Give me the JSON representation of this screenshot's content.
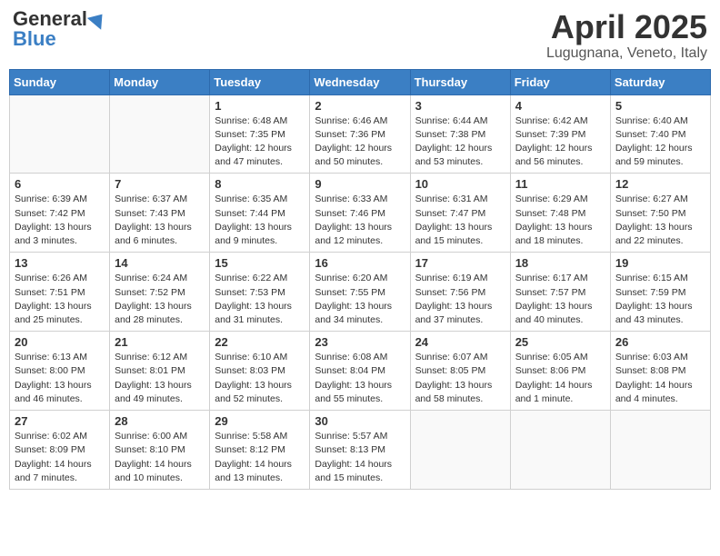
{
  "header": {
    "logo_general": "General",
    "logo_blue": "Blue",
    "title": "April 2025",
    "location": "Lugugnana, Veneto, Italy"
  },
  "weekdays": [
    "Sunday",
    "Monday",
    "Tuesday",
    "Wednesday",
    "Thursday",
    "Friday",
    "Saturday"
  ],
  "weeks": [
    [
      {
        "day": "",
        "info": ""
      },
      {
        "day": "",
        "info": ""
      },
      {
        "day": "1",
        "info": "Sunrise: 6:48 AM\nSunset: 7:35 PM\nDaylight: 12 hours and 47 minutes."
      },
      {
        "day": "2",
        "info": "Sunrise: 6:46 AM\nSunset: 7:36 PM\nDaylight: 12 hours and 50 minutes."
      },
      {
        "day": "3",
        "info": "Sunrise: 6:44 AM\nSunset: 7:38 PM\nDaylight: 12 hours and 53 minutes."
      },
      {
        "day": "4",
        "info": "Sunrise: 6:42 AM\nSunset: 7:39 PM\nDaylight: 12 hours and 56 minutes."
      },
      {
        "day": "5",
        "info": "Sunrise: 6:40 AM\nSunset: 7:40 PM\nDaylight: 12 hours and 59 minutes."
      }
    ],
    [
      {
        "day": "6",
        "info": "Sunrise: 6:39 AM\nSunset: 7:42 PM\nDaylight: 13 hours and 3 minutes."
      },
      {
        "day": "7",
        "info": "Sunrise: 6:37 AM\nSunset: 7:43 PM\nDaylight: 13 hours and 6 minutes."
      },
      {
        "day": "8",
        "info": "Sunrise: 6:35 AM\nSunset: 7:44 PM\nDaylight: 13 hours and 9 minutes."
      },
      {
        "day": "9",
        "info": "Sunrise: 6:33 AM\nSunset: 7:46 PM\nDaylight: 13 hours and 12 minutes."
      },
      {
        "day": "10",
        "info": "Sunrise: 6:31 AM\nSunset: 7:47 PM\nDaylight: 13 hours and 15 minutes."
      },
      {
        "day": "11",
        "info": "Sunrise: 6:29 AM\nSunset: 7:48 PM\nDaylight: 13 hours and 18 minutes."
      },
      {
        "day": "12",
        "info": "Sunrise: 6:27 AM\nSunset: 7:50 PM\nDaylight: 13 hours and 22 minutes."
      }
    ],
    [
      {
        "day": "13",
        "info": "Sunrise: 6:26 AM\nSunset: 7:51 PM\nDaylight: 13 hours and 25 minutes."
      },
      {
        "day": "14",
        "info": "Sunrise: 6:24 AM\nSunset: 7:52 PM\nDaylight: 13 hours and 28 minutes."
      },
      {
        "day": "15",
        "info": "Sunrise: 6:22 AM\nSunset: 7:53 PM\nDaylight: 13 hours and 31 minutes."
      },
      {
        "day": "16",
        "info": "Sunrise: 6:20 AM\nSunset: 7:55 PM\nDaylight: 13 hours and 34 minutes."
      },
      {
        "day": "17",
        "info": "Sunrise: 6:19 AM\nSunset: 7:56 PM\nDaylight: 13 hours and 37 minutes."
      },
      {
        "day": "18",
        "info": "Sunrise: 6:17 AM\nSunset: 7:57 PM\nDaylight: 13 hours and 40 minutes."
      },
      {
        "day": "19",
        "info": "Sunrise: 6:15 AM\nSunset: 7:59 PM\nDaylight: 13 hours and 43 minutes."
      }
    ],
    [
      {
        "day": "20",
        "info": "Sunrise: 6:13 AM\nSunset: 8:00 PM\nDaylight: 13 hours and 46 minutes."
      },
      {
        "day": "21",
        "info": "Sunrise: 6:12 AM\nSunset: 8:01 PM\nDaylight: 13 hours and 49 minutes."
      },
      {
        "day": "22",
        "info": "Sunrise: 6:10 AM\nSunset: 8:03 PM\nDaylight: 13 hours and 52 minutes."
      },
      {
        "day": "23",
        "info": "Sunrise: 6:08 AM\nSunset: 8:04 PM\nDaylight: 13 hours and 55 minutes."
      },
      {
        "day": "24",
        "info": "Sunrise: 6:07 AM\nSunset: 8:05 PM\nDaylight: 13 hours and 58 minutes."
      },
      {
        "day": "25",
        "info": "Sunrise: 6:05 AM\nSunset: 8:06 PM\nDaylight: 14 hours and 1 minute."
      },
      {
        "day": "26",
        "info": "Sunrise: 6:03 AM\nSunset: 8:08 PM\nDaylight: 14 hours and 4 minutes."
      }
    ],
    [
      {
        "day": "27",
        "info": "Sunrise: 6:02 AM\nSunset: 8:09 PM\nDaylight: 14 hours and 7 minutes."
      },
      {
        "day": "28",
        "info": "Sunrise: 6:00 AM\nSunset: 8:10 PM\nDaylight: 14 hours and 10 minutes."
      },
      {
        "day": "29",
        "info": "Sunrise: 5:58 AM\nSunset: 8:12 PM\nDaylight: 14 hours and 13 minutes."
      },
      {
        "day": "30",
        "info": "Sunrise: 5:57 AM\nSunset: 8:13 PM\nDaylight: 14 hours and 15 minutes."
      },
      {
        "day": "",
        "info": ""
      },
      {
        "day": "",
        "info": ""
      },
      {
        "day": "",
        "info": ""
      }
    ]
  ]
}
